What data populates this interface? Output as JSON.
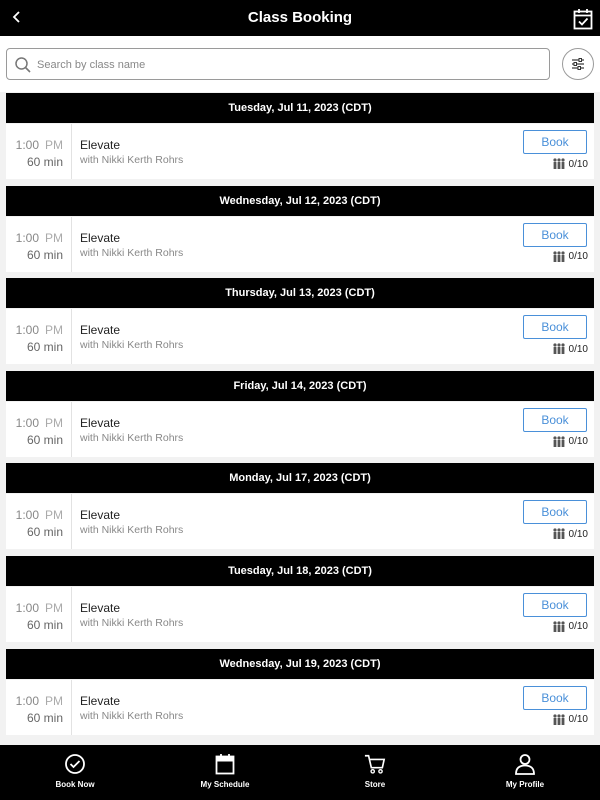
{
  "header": {
    "title": "Class Booking"
  },
  "search": {
    "placeholder": "Search by class name"
  },
  "days": [
    {
      "date": "Tuesday, Jul 11, 2023 (CDT)",
      "time": "1:00",
      "ampm": "PM",
      "duration": "60 min",
      "name": "Elevate",
      "instructor": "with Nikki Kerth Rohrs",
      "book": "Book",
      "capacity": "0/10"
    },
    {
      "date": "Wednesday, Jul 12, 2023 (CDT)",
      "time": "1:00",
      "ampm": "PM",
      "duration": "60 min",
      "name": "Elevate",
      "instructor": "with Nikki Kerth Rohrs",
      "book": "Book",
      "capacity": "0/10"
    },
    {
      "date": "Thursday, Jul 13, 2023 (CDT)",
      "time": "1:00",
      "ampm": "PM",
      "duration": "60 min",
      "name": "Elevate",
      "instructor": "with Nikki Kerth Rohrs",
      "book": "Book",
      "capacity": "0/10"
    },
    {
      "date": "Friday, Jul 14, 2023 (CDT)",
      "time": "1:00",
      "ampm": "PM",
      "duration": "60 min",
      "name": "Elevate",
      "instructor": "with Nikki Kerth Rohrs",
      "book": "Book",
      "capacity": "0/10"
    },
    {
      "date": "Monday, Jul 17, 2023 (CDT)",
      "time": "1:00",
      "ampm": "PM",
      "duration": "60 min",
      "name": "Elevate",
      "instructor": "with Nikki Kerth Rohrs",
      "book": "Book",
      "capacity": "0/10"
    },
    {
      "date": "Tuesday, Jul 18, 2023 (CDT)",
      "time": "1:00",
      "ampm": "PM",
      "duration": "60 min",
      "name": "Elevate",
      "instructor": "with Nikki Kerth Rohrs",
      "book": "Book",
      "capacity": "0/10"
    },
    {
      "date": "Wednesday, Jul 19, 2023 (CDT)",
      "time": "1:00",
      "ampm": "PM",
      "duration": "60 min",
      "name": "Elevate",
      "instructor": "with Nikki Kerth Rohrs",
      "book": "Book",
      "capacity": "0/10"
    }
  ],
  "tabs": [
    {
      "label": "Book Now",
      "icon": "check-circle-icon"
    },
    {
      "label": "My Schedule",
      "icon": "calendar-icon"
    },
    {
      "label": "Store",
      "icon": "cart-icon"
    },
    {
      "label": "My Profile",
      "icon": "person-icon"
    }
  ],
  "colors": {
    "accent": "#4a90d9",
    "bar": "#000000",
    "background": "#f2f2f2"
  }
}
